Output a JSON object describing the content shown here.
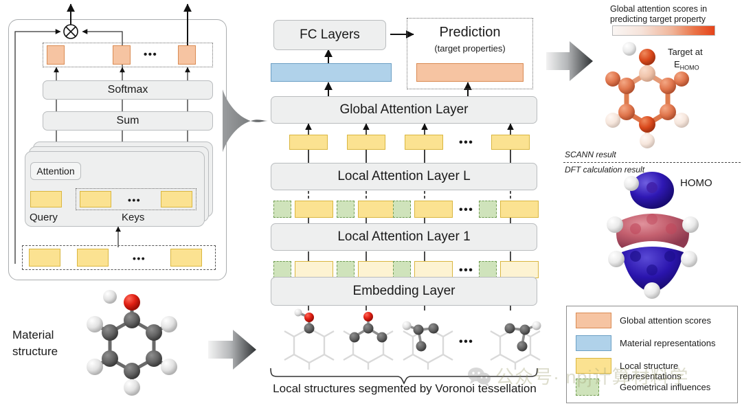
{
  "left_panel": {
    "softmax_label": "Softmax",
    "sum_label": "Sum",
    "attention_label": "Attention",
    "query_label": "Query",
    "keys_label": "Keys",
    "ellipsis": "•••",
    "multiply_symbol": "⊗",
    "attention_scores_row": [
      "score-1",
      "score-2",
      "score-n"
    ],
    "key_boxes": [
      "key-1",
      "key-n"
    ],
    "input_boxes": [
      "input-1",
      "input-2",
      "input-n"
    ]
  },
  "material": {
    "label_line1": "Material",
    "label_line2": "structure",
    "molecule": "phenol-ball-and-stick"
  },
  "center": {
    "fc_layers_label": "FC Layers",
    "prediction_title": "Prediction",
    "prediction_subtitle": "(target properties)",
    "global_attention_label": "Global Attention Layer",
    "local_attention_L_label": "Local Attention Layer L",
    "local_attention_1_label": "Local Attention Layer 1",
    "embedding_label": "Embedding Layer",
    "voronoi_caption": "Local structures segmented by Voronoi tessellation",
    "ellipsis": "•••",
    "material_representation_bar": "material-representations",
    "prediction_bar": "global-attention-scores",
    "token_count": 4
  },
  "right": {
    "colorbar_title_line1": "Global attention scores in",
    "colorbar_title_line2": "predicting target property",
    "colorbar_low_color": "#f7f2ef",
    "colorbar_high_color": "#e5431a",
    "target_line1": "Target at",
    "target_symbol": "E",
    "target_subscript": "HOMO",
    "scann_result": "SCANN result",
    "dft_result": "DFT calculation result",
    "homo_label": "HOMO"
  },
  "legend": {
    "items": [
      {
        "label": "Global attention scores",
        "swatch": "salmon"
      },
      {
        "label": "Material representations",
        "swatch": "blue"
      },
      {
        "label": "Local structure representations",
        "swatch": "yellow"
      },
      {
        "label": "Geometrical influences",
        "swatch": "green-dashed"
      }
    ]
  },
  "watermark": {
    "text": "公众号· npj计算材料学",
    "icon": "wechat-icon"
  }
}
